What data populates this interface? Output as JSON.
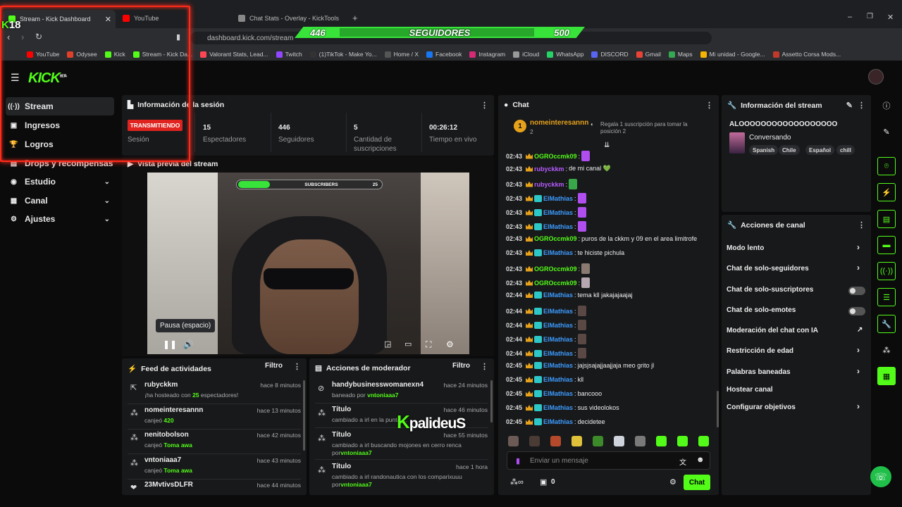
{
  "browser": {
    "tabs": [
      "Stream - Kick Dashboard",
      "YouTube",
      "Chat Stats - Overlay - KickTools"
    ],
    "url": "dashboard.kick.com/stream",
    "bookmarks": [
      "YouTube",
      "Odysee",
      "Kick",
      "Stream - Kick Da...",
      "Valorant Stats, Lead...",
      "Twitch",
      "(1)TikTok - Make Yo...",
      "Home / X",
      "Facebook",
      "Instagram",
      "iCloud",
      "WhatsApp",
      "DISCORD",
      "Gmail",
      "Maps",
      "Mi unidad - Google...",
      "Assetto Corsa Mods..."
    ]
  },
  "overlay": {
    "followers_left": "446",
    "followers_label": "SEGUIDORES",
    "followers_goal": "500",
    "age_badge_k": "K",
    "age_badge_num": "18",
    "sub_bar_label": "SUBSCRIBERS",
    "sub_bar_value": "25",
    "sub_bar_fraction": 0.22,
    "watermark_k": "K",
    "watermark_text": "palideuS"
  },
  "app": {
    "logo": "KICK",
    "logo_beta": "BETA"
  },
  "sidebar": {
    "items": [
      {
        "label": "Stream",
        "icon": "broadcast-icon"
      },
      {
        "label": "Ingresos",
        "icon": "wallet-icon"
      },
      {
        "label": "Logros",
        "icon": "trophy-icon"
      },
      {
        "label": "Drops y recompensas",
        "icon": "gift-icon"
      },
      {
        "label": "Estudio",
        "icon": "studio-icon"
      },
      {
        "label": "Canal",
        "icon": "channel-icon"
      },
      {
        "label": "Ajustes",
        "icon": "gear-icon"
      }
    ]
  },
  "session": {
    "title": "Información de la sesión",
    "status": "TRANSMITIENDO",
    "status_label": "Sesión",
    "viewers": "15",
    "viewers_label": "Espectadores",
    "followers": "446",
    "followers_label": "Seguidores",
    "subs": "5",
    "subs_label": "Cantidad de suscripciones",
    "uptime": "00:26:12",
    "uptime_label": "Tiempo en vivo"
  },
  "video": {
    "title": "Vista previa del stream",
    "tooltip": "Pausa (espacio)"
  },
  "feed": {
    "title": "Feed de actividades",
    "filter": "Filtro",
    "items": [
      {
        "user": "rubyckkm",
        "pre": "¡ha hosteado con ",
        "hl": "25",
        "post": " espectadores!",
        "time": "hace 8 minutos"
      },
      {
        "user": "nomeinteresannn",
        "pre": "canjeó ",
        "hl": "420",
        "post": "",
        "time": "hace 13 minutos"
      },
      {
        "user": "nenitobolson",
        "pre": "canjeó ",
        "hl": "Toma awa",
        "post": "",
        "time": "hace 42 minutos"
      },
      {
        "user": "vntoniaaa7",
        "pre": "canjeó ",
        "hl": "Toma awa",
        "post": "",
        "time": "hace 43 minutos"
      },
      {
        "user": "23MvtivsDLFR",
        "pre": "",
        "hl": "",
        "post": "",
        "time": "hace 44 minutos"
      }
    ]
  },
  "mod": {
    "title": "Acciones de moderador",
    "filter": "Filtro",
    "items": [
      {
        "title": "handybusinesswomanexn4",
        "sub": "baneado por ",
        "who": "vntoniaaa7",
        "time": "hace 24 minutos"
      },
      {
        "title": "Título",
        "sub": "cambiado a irl en la punta ...",
        "who": "",
        "time": "hace 46 minutos"
      },
      {
        "title": "Título",
        "sub": "cambiado a irl buscando mojones en cerro renca por",
        "who": "vntoniaaa7",
        "time": "hace 55 minutos"
      },
      {
        "title": "Título",
        "sub": "cambiado a irl randonautica con los comparixuuu por",
        "who": "vntoniaaa7",
        "time": "hace 1 hora"
      }
    ]
  },
  "chat": {
    "title": "Chat",
    "pinned_user": "nomeinteresannn",
    "pinned_rank": "1",
    "pinned_count": "2",
    "pinned_msg": "Regala 1 suscripción para tomar la posición 2",
    "messages": [
      {
        "time": "02:43",
        "user": "OGROccmk09",
        "color": "#53fc18",
        "text": "",
        "emote": "#b04ef0",
        "badge": false
      },
      {
        "time": "02:43",
        "user": "rubyckkm",
        "color": "#b65cff",
        "text": "de mi canal 💚",
        "emote": "",
        "badge": false
      },
      {
        "time": "02:43",
        "user": "rubyckkm",
        "color": "#b65cff",
        "text": "",
        "emote": "#3aa64a",
        "badge": false
      },
      {
        "time": "02:43",
        "user": "ElMathias",
        "color": "#3d9cff",
        "text": "",
        "emote": "#b04ef0",
        "badge": true
      },
      {
        "time": "02:43",
        "user": "ElMathias",
        "color": "#3d9cff",
        "text": "",
        "emote": "#b04ef0",
        "badge": true
      },
      {
        "time": "02:43",
        "user": "ElMathias",
        "color": "#3d9cff",
        "text": "",
        "emote": "#b04ef0",
        "badge": true
      },
      {
        "time": "02:43",
        "user": "OGROccmk09",
        "color": "#53fc18",
        "text": "puros de la ckkm y 09 en el area limitrofe",
        "emote": "",
        "badge": false
      },
      {
        "time": "02:43",
        "user": "ElMathias",
        "color": "#3d9cff",
        "text": "te hiciste pichula",
        "emote": "",
        "badge": true
      },
      {
        "time": "02:43",
        "user": "OGROccmk09",
        "color": "#53fc18",
        "text": "",
        "emote": "#8a7a72",
        "badge": false
      },
      {
        "time": "02:43",
        "user": "OGROccmk09",
        "color": "#53fc18",
        "text": "",
        "emote": "#b6a8b0",
        "badge": false
      },
      {
        "time": "02:44",
        "user": "ElMathias",
        "color": "#3d9cff",
        "text": "tema kll jakajajaajaj",
        "emote": "",
        "badge": true
      },
      {
        "time": "02:44",
        "user": "ElMathias",
        "color": "#3d9cff",
        "text": "",
        "emote": "#5a4844",
        "badge": true
      },
      {
        "time": "02:44",
        "user": "ElMathias",
        "color": "#3d9cff",
        "text": "",
        "emote": "#5a4844",
        "badge": true
      },
      {
        "time": "02:44",
        "user": "ElMathias",
        "color": "#3d9cff",
        "text": "",
        "emote": "#5a4844",
        "badge": true
      },
      {
        "time": "02:44",
        "user": "ElMathias",
        "color": "#3d9cff",
        "text": "",
        "emote": "#5a4844",
        "badge": true
      },
      {
        "time": "02:45",
        "user": "ElMathias",
        "color": "#3d9cff",
        "text": "jajsjsajajjaajjaja meo grito jl",
        "emote": "",
        "badge": true
      },
      {
        "time": "02:45",
        "user": "ElMathias",
        "color": "#3d9cff",
        "text": "kll",
        "emote": "",
        "badge": true
      },
      {
        "time": "02:45",
        "user": "ElMathias",
        "color": "#3d9cff",
        "text": "bancooo",
        "emote": "",
        "badge": true
      },
      {
        "time": "02:45",
        "user": "ElMathias",
        "color": "#3d9cff",
        "text": "sus videolokos",
        "emote": "",
        "badge": true
      },
      {
        "time": "02:45",
        "user": "ElMathias",
        "color": "#3d9cff",
        "text": "decidetee",
        "emote": "",
        "badge": true
      }
    ],
    "emote_row": [
      "#6b5a55",
      "#4b3b35",
      "#b44a2b",
      "#e0c23a",
      "#3d8a2a",
      "#cfd4dc",
      "#7a7a7a",
      "#53fc18",
      "#53fc18",
      "#53fc18"
    ],
    "input_placeholder": "Enviar un mensaje",
    "points": "0",
    "send": "Chat"
  },
  "stream_info": {
    "title": "Información del stream",
    "stream_title": "ALOOOOOOOOOOOOOOOOOO",
    "category": "Conversando",
    "tags": [
      "Spanish",
      "Chile",
      "Español",
      "chill"
    ]
  },
  "channel_actions": {
    "title": "Acciones de canal",
    "items": [
      {
        "label": "Modo lento",
        "control": "chevron"
      },
      {
        "label": "Chat de solo-seguidores",
        "control": "chevron"
      },
      {
        "label": "Chat de solo-suscriptores",
        "control": "toggle"
      },
      {
        "label": "Chat de solo-emotes",
        "control": "toggle"
      },
      {
        "label": "Moderación del chat con IA",
        "control": "external"
      },
      {
        "label": "Restricción de edad",
        "control": "chevron"
      },
      {
        "label": "Palabras baneadas",
        "control": "chevron"
      },
      {
        "label": "Hostear canal",
        "control": "none"
      },
      {
        "label": "Configurar objetivos",
        "control": "chevron"
      }
    ]
  },
  "colors": {
    "accent": "#53fc18",
    "live": "#e0231e"
  }
}
